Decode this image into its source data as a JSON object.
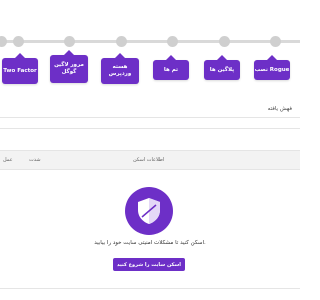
{
  "steps": [
    {
      "label": "Two Factor"
    },
    {
      "label": "مرور لاگین گوگل"
    },
    {
      "label": "هسته وردپرس"
    },
    {
      "label": "تم ها"
    },
    {
      "label": "پلاگین ها"
    },
    {
      "label": "نصب Rogue"
    }
  ],
  "scan": {
    "found_label": "فهش یافته",
    "columns": {
      "info": "اطلاعات اسکن",
      "severity": "شدت",
      "action": "عمل"
    },
    "empty_message": "اسکن کنید تا مشکلات امنیتی سایت خود را بیابید.",
    "start_button": "اسکن سایت را شروع کنید"
  },
  "colors": {
    "accent": "#6d2fc7",
    "track": "#d9d9d9"
  },
  "icons": {
    "empty_state": "shield-icon"
  }
}
